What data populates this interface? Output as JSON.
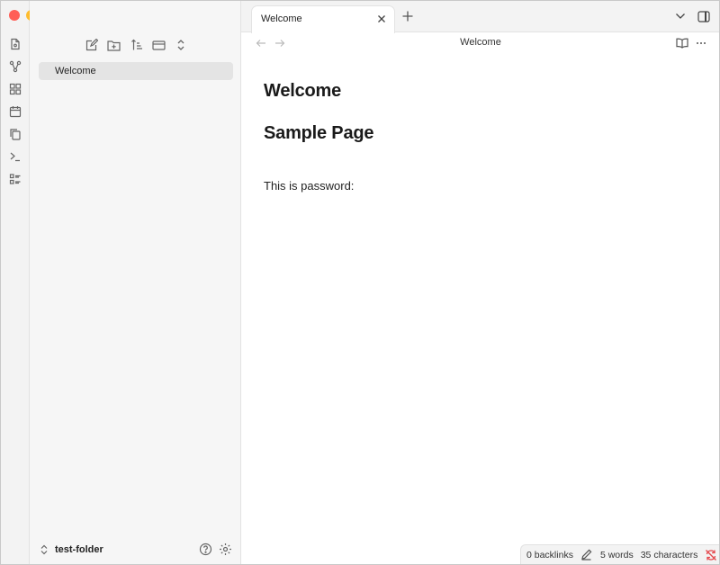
{
  "sidebar": {
    "files": [
      {
        "label": "Welcome"
      }
    ],
    "vault_name": "test-folder"
  },
  "tabs": [
    {
      "label": "Welcome"
    }
  ],
  "view": {
    "title": "Welcome"
  },
  "document": {
    "heading1": "Welcome",
    "heading2": "Sample Page",
    "paragraph": "This is password:"
  },
  "statusbar": {
    "backlinks": "0 backlinks",
    "words": "5 words",
    "characters": "35 characters"
  },
  "colors": {
    "close": "#ff5f57",
    "minimize": "#febc2e",
    "zoom": "#28c840",
    "sync_error": "#e5484d"
  },
  "icons": {
    "ribbon": [
      "file-icon",
      "graph-icon",
      "canvas-icon",
      "calendar-icon",
      "copy-icon",
      "terminal-icon",
      "list-icon"
    ]
  }
}
